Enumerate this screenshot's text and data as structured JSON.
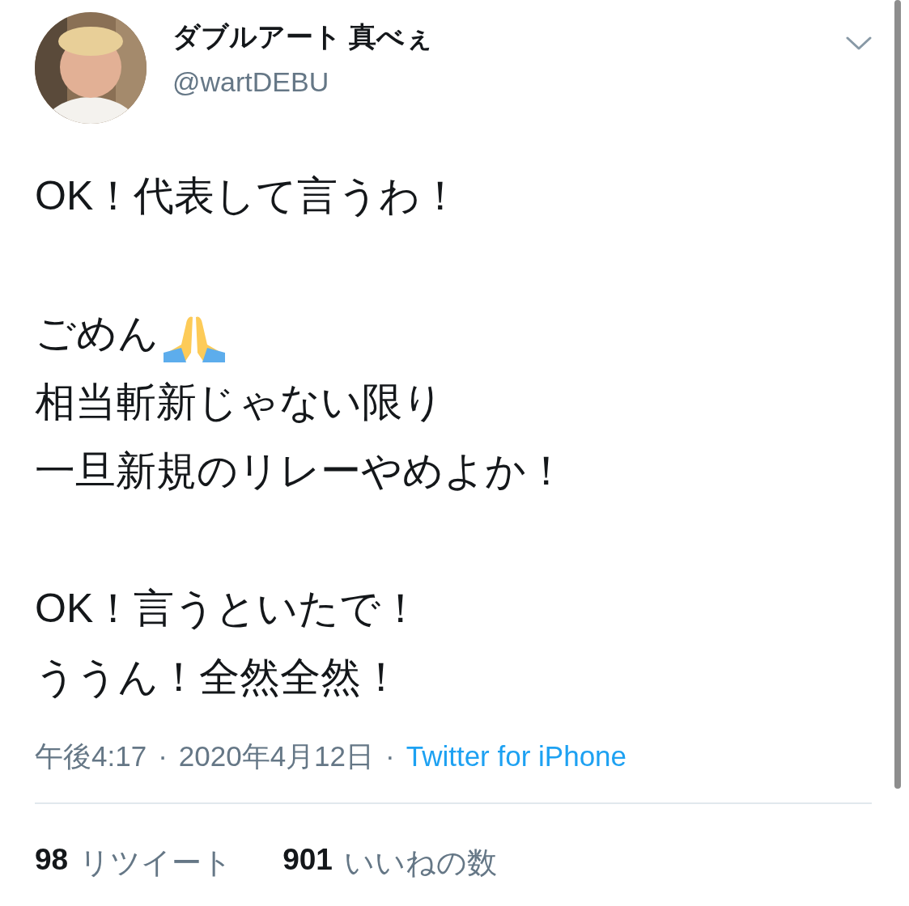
{
  "author": {
    "display_name": "ダブルアート 真べぇ",
    "handle": "@wartDEBU"
  },
  "tweet": {
    "paragraphs": [
      {
        "lines": [
          {
            "text": "OK！代表して言うわ！",
            "kind": "plain"
          }
        ]
      },
      {
        "lines": [
          {
            "text": "ごめん",
            "kind": "icon_after"
          },
          {
            "text": "相当斬新じゃない限り",
            "kind": "plain"
          },
          {
            "text": "一旦新規のリレーやめよか！",
            "kind": "plain"
          }
        ]
      },
      {
        "lines": [
          {
            "text": "OK！言うといたで！",
            "kind": "plain"
          },
          {
            "text": "ううん！全然全然！",
            "kind": "plain"
          }
        ]
      }
    ]
  },
  "meta": {
    "time": "午後4:17",
    "separator_1": "·",
    "date": "2020年4月12日",
    "separator_2": "·",
    "source": "Twitter for iPhone"
  },
  "stats": [
    {
      "count": "98",
      "label": "リツイート"
    },
    {
      "count": "901",
      "label": "いいねの数"
    }
  ]
}
